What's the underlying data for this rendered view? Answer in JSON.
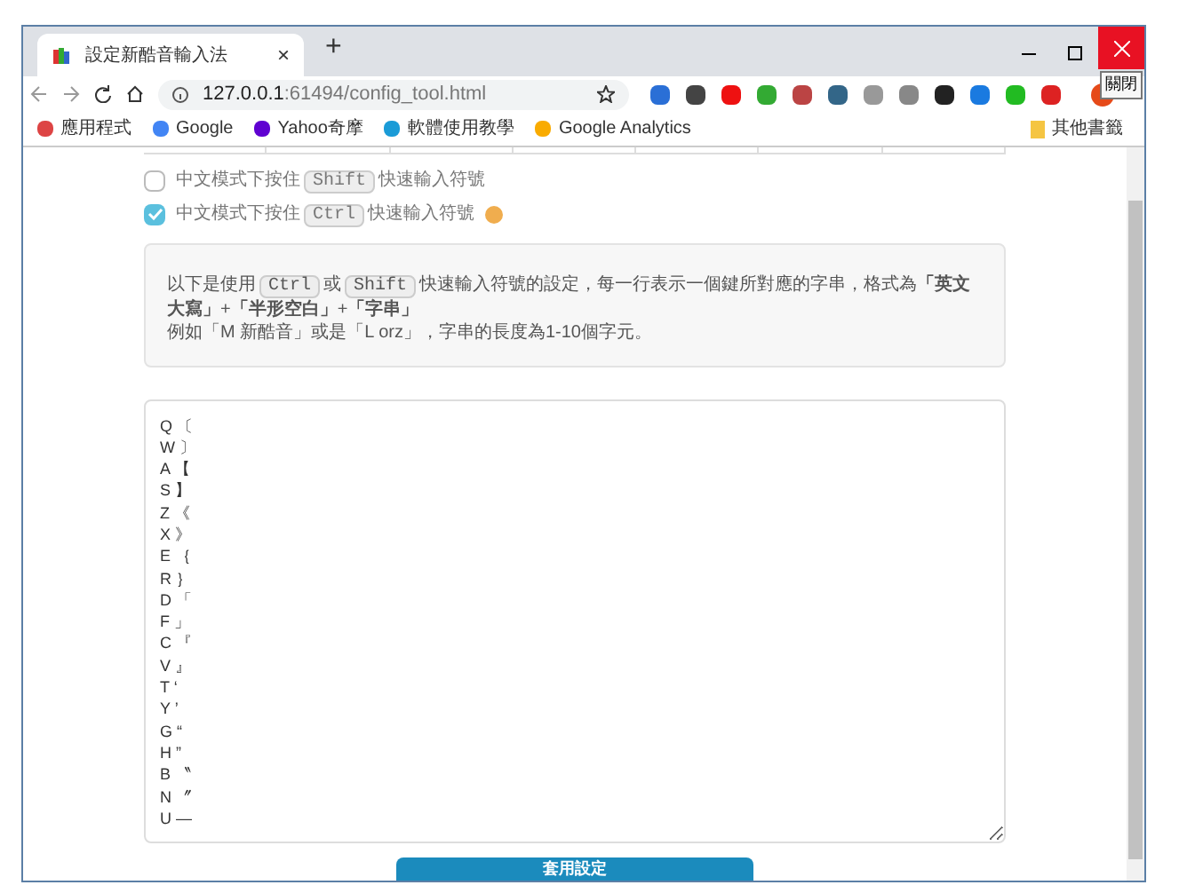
{
  "tab": {
    "title": "設定新酷音輸入法",
    "close": "×",
    "new_tab": "+"
  },
  "tooltip": "關閉",
  "address": {
    "host": "127.0.0.1",
    "path": ":61494/config_tool.html"
  },
  "bookmarks": [
    {
      "label": "應用程式"
    },
    {
      "label": "Google"
    },
    {
      "label": "Yahoo奇摩"
    },
    {
      "label": "軟體使用教學"
    },
    {
      "label": "Google Analytics"
    }
  ],
  "other_bookmarks": "其他書籤",
  "options": [
    {
      "prefix": "中文模式下按住",
      "key": "Shift",
      "suffix": "快速輸入符號",
      "checked": false,
      "info": false
    },
    {
      "prefix": "中文模式下按住",
      "key": "Ctrl",
      "suffix": "快速輸入符號",
      "checked": true,
      "info": true
    }
  ],
  "help": {
    "segments": [
      {
        "kind": "text",
        "text": "以下是使用"
      },
      {
        "kind": "key",
        "text": "Ctrl"
      },
      {
        "kind": "text",
        "text": "或"
      },
      {
        "kind": "key",
        "text": "Shift"
      },
      {
        "kind": "text",
        "text": "快速輸入符號的設定，每一行表示一個鍵所對應的字串，格式為**「英文大寫」**+**「半形空白」**+**「字串」**"
      }
    ],
    "example": "例如「M 新酷音」或是「L orz」，字串的長度為1-10個字元。"
  },
  "mappings": [
    "Q 〔",
    "W 〕",
    "A 【",
    "S 】",
    "Z 《",
    "X 》",
    "E ｛",
    "R ｝",
    "D 「",
    "F 」",
    "C 『",
    "V 』",
    "T ‘",
    "Y ’",
    "G “",
    "H ”",
    "B 〝",
    "N 〞",
    "U —"
  ],
  "apply_button": "套用設定"
}
